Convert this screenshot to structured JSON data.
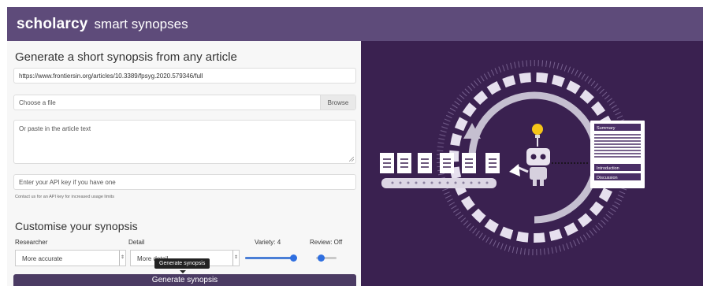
{
  "header": {
    "brand": "scholarcy",
    "product": "smart synopses"
  },
  "form": {
    "title": "Generate a short synopsis from any article",
    "url_value": "https://www.frontiersin.org/articles/10.3389/fpsyg.2020.579346/full",
    "file_placeholder": "Choose a file",
    "browse_label": "Browse",
    "text_placeholder": "Or paste in the article text",
    "apikey_placeholder": "Enter your API key if you have one",
    "apikey_note": "Contact us for an API key for increased usage limits"
  },
  "customise": {
    "title": "Customise your synopsis",
    "researcher_label": "Researcher",
    "researcher_value": "More accurate",
    "detail_label": "Detail",
    "detail_value": "More detail",
    "variety_label": "Variety: 4",
    "variety_value": 4,
    "review_label": "Review: Off",
    "tooltip": "Generate synopsis",
    "generate_label": "Generate synopsis"
  },
  "illustration": {
    "card_items": [
      "Summary",
      "Introduction",
      "Discussion"
    ]
  },
  "colors": {
    "header": "#5e4b7a",
    "panel": "#3a2150",
    "accent": "#2f6fe0",
    "button": "#4b3b63"
  }
}
